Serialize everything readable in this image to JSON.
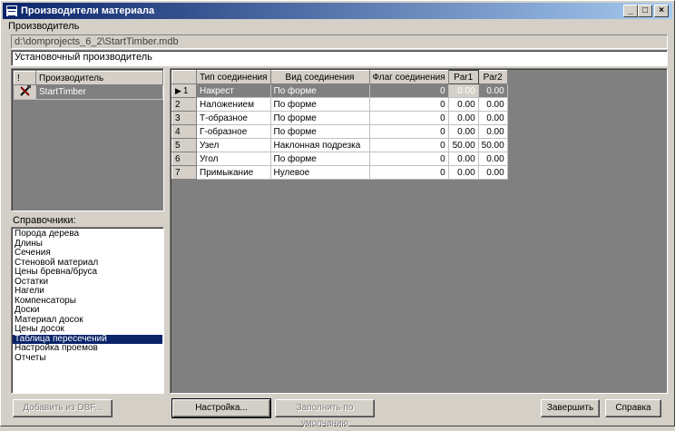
{
  "window": {
    "title": "Производители материала",
    "minimize": "_",
    "maximize": "□",
    "close": "×"
  },
  "producer_label": "Производитель",
  "db_path": "d:\\domprojects_6_2\\StartTimber.mdb",
  "installed_producer": "Установочный производитель",
  "producers_table": {
    "headers": [
      "!",
      "Производитель"
    ],
    "rows": [
      {
        "flag_icon": "tools-icon",
        "name": "StartTimber"
      }
    ]
  },
  "references_label": "Справочники:",
  "references": [
    "Порода дерева",
    "Длины",
    "Сечения",
    "Стеновой материал",
    "Цены бревна/бруса",
    "Остатки",
    "Нагели",
    "Компенсаторы",
    "Доски",
    "Материал досок",
    "Цены досок",
    "Таблица пересечений",
    "Настройка проемов",
    "Отчеты"
  ],
  "selected_reference_index": 11,
  "joins_table": {
    "headers": [
      "",
      "Тип соединения",
      "Вид соединения",
      "Флаг соединения",
      "Par1",
      "Par2"
    ],
    "rows": [
      [
        "1",
        "Накрест",
        "По форме",
        "0",
        "0.00",
        "0.00"
      ],
      [
        "2",
        "Наложением",
        "По форме",
        "0",
        "0.00",
        "0.00"
      ],
      [
        "3",
        "Т-образное",
        "По форме",
        "0",
        "0.00",
        "0.00"
      ],
      [
        "4",
        "Г-образное",
        "По форме",
        "0",
        "0.00",
        "0.00"
      ],
      [
        "5",
        "Узел",
        "Наклонная подрезка",
        "0",
        "50.00",
        "50.00"
      ],
      [
        "6",
        "Угол",
        "По форме",
        "0",
        "0.00",
        "0.00"
      ],
      [
        "7",
        "Примыкание",
        "Нулевое",
        "0",
        "0.00",
        "0.00"
      ]
    ],
    "selected_row": 0
  },
  "buttons": {
    "add_dbf": "Добавить из DBF...",
    "settings": "Настройка...",
    "fill_default": "Заполнить по умолчанию",
    "finish": "Завершить",
    "help": "Справка"
  },
  "colors": {
    "titlebar_start": "#0a246a",
    "titlebar_end": "#a6caf0",
    "selection": "#0a246a",
    "face": "#d4d0c8"
  }
}
